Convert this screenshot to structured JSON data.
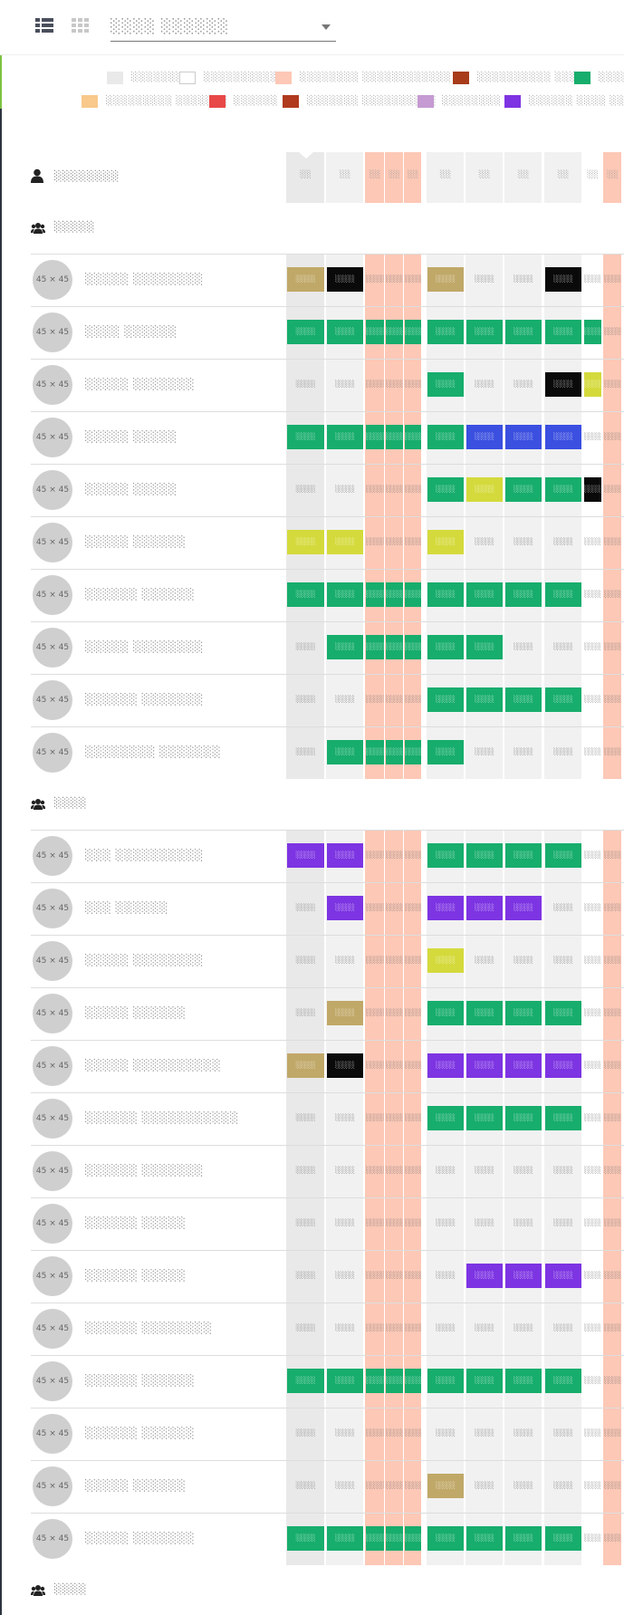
{
  "topbar": {
    "list_view_icon": "list-view-icon",
    "grid_view_icon": "grid-view-icon",
    "dropdown_value": "░░░░ ░░░░░░",
    "dropdown_icon": "chevron-down-icon"
  },
  "colors": {
    "gray": "#e9e9e9",
    "white": "#ffffff",
    "salmon": "#fdc8b6",
    "brown": "#a83c1b",
    "green": "#17ad6c",
    "peach": "#f8c98a",
    "red": "#e84848",
    "rust": "#b03a1e",
    "lilac": "#c69ad2",
    "purple": "#7d34e2",
    "khaki": "#c0a868",
    "black": "#0a0a0a",
    "lime": "#d4da3c",
    "blue": "#3b4fe0",
    "sidebar": "#2f3440",
    "accent": "#7cc242"
  },
  "legend": [
    {
      "color": "gray",
      "label": "░░░░░░░"
    },
    {
      "color": "white",
      "label": "░░░░░░░░░░░"
    },
    {
      "color": "salmon",
      "label": "░░░░░░░░ ░░░░░░░░░░░░"
    },
    {
      "color": "brown",
      "label": "░░░░░░░░░░ ░░░"
    },
    {
      "color": "green",
      "label": "░░░░░"
    },
    {
      "color": "peach",
      "label": "░░░░░░░░░ ░░░░░░░"
    },
    {
      "color": "red",
      "label": "░░░░░░"
    },
    {
      "color": "rust",
      "label": "░░░░░░░ ░░░░░░░░░░"
    },
    {
      "color": "lilac",
      "label": "░░░░░░░░"
    },
    {
      "color": "purple",
      "label": "░░░░░░ ░░░░ ░░░░░"
    }
  ],
  "header": {
    "icon": "user-icon",
    "label": "░░░░░░░░",
    "cells": [
      "░░",
      "░░",
      "░░",
      "░░",
      "░░",
      "░░",
      "░░",
      "░░",
      "░░",
      "░░",
      "░░",
      "░░"
    ]
  },
  "groups": [
    {
      "icon": "users-icon",
      "label": "░░░░░",
      "people": [
        {
          "avatar": "45 × 45",
          "name": "░░░░░ ░░░░░░░░",
          "cells": [
            "khaki",
            "black",
            "",
            "",
            "",
            "khaki",
            "",
            "",
            "black",
            "",
            "",
            ""
          ]
        },
        {
          "avatar": "45 × 45",
          "name": "░░░░ ░░░░░░",
          "cells": [
            "green",
            "green",
            "green",
            "green",
            "green",
            "green",
            "green",
            "green",
            "green",
            "green",
            "",
            ""
          ]
        },
        {
          "avatar": "45 × 45",
          "name": "░░░░░ ░░░░░░░",
          "cells": [
            "",
            "",
            "",
            "",
            "",
            "green",
            "",
            "",
            "black",
            "lime",
            "",
            ""
          ]
        },
        {
          "avatar": "45 × 45",
          "name": "░░░░░ ░░░░░",
          "cells": [
            "green",
            "green",
            "green",
            "green",
            "green",
            "green",
            "blue",
            "blue",
            "blue",
            "",
            "",
            ""
          ]
        },
        {
          "avatar": "45 × 45",
          "name": "░░░░░ ░░░░░",
          "cells": [
            "",
            "",
            "",
            "",
            "",
            "green",
            "lime",
            "green",
            "green",
            "black",
            "",
            ""
          ]
        },
        {
          "avatar": "45 × 45",
          "name": "░░░░░ ░░░░░░",
          "cells": [
            "lime",
            "lime",
            "",
            "",
            "",
            "lime",
            "",
            "",
            "",
            "",
            "",
            ""
          ]
        },
        {
          "avatar": "45 × 45",
          "name": "░░░░░░ ░░░░░░",
          "cells": [
            "green",
            "green",
            "green",
            "green",
            "green",
            "green",
            "green",
            "green",
            "green",
            "",
            "",
            ""
          ]
        },
        {
          "avatar": "45 × 45",
          "name": "░░░░░ ░░░░░░░░",
          "cells": [
            "",
            "green",
            "green",
            "green",
            "green",
            "green",
            "green",
            "",
            "",
            "",
            "",
            ""
          ]
        },
        {
          "avatar": "45 × 45",
          "name": "░░░░░░ ░░░░░░░",
          "cells": [
            "",
            "",
            "",
            "",
            "",
            "green",
            "green",
            "green",
            "green",
            "",
            "",
            ""
          ]
        },
        {
          "avatar": "45 × 45",
          "name": "░░░░░░░░ ░░░░░░░",
          "cells": [
            "",
            "green",
            "green",
            "green",
            "green",
            "green",
            "",
            "",
            "",
            "",
            "",
            ""
          ]
        }
      ]
    },
    {
      "icon": "users-icon",
      "label": "░░░░",
      "people": [
        {
          "avatar": "45 × 45",
          "name": "░░░ ░░░░░░░░░░",
          "cells": [
            "purple",
            "purple",
            "",
            "",
            "",
            "green",
            "green",
            "green",
            "green",
            "",
            "",
            ""
          ]
        },
        {
          "avatar": "45 × 45",
          "name": "░░░ ░░░░░░",
          "cells": [
            "",
            "purple",
            "",
            "",
            "",
            "purple",
            "purple",
            "purple",
            "",
            "",
            "",
            ""
          ]
        },
        {
          "avatar": "45 × 45",
          "name": "░░░░░ ░░░░░░░░",
          "cells": [
            "",
            "",
            "",
            "",
            "",
            "lime",
            "",
            "",
            "",
            "",
            "",
            ""
          ]
        },
        {
          "avatar": "45 × 45",
          "name": "░░░░░ ░░░░░░",
          "cells": [
            "",
            "khaki",
            "",
            "",
            "",
            "green",
            "green",
            "green",
            "green",
            "",
            "",
            ""
          ]
        },
        {
          "avatar": "45 × 45",
          "name": "░░░░░ ░░░░░░░░░░",
          "cells": [
            "khaki",
            "black",
            "",
            "",
            "",
            "purple",
            "purple",
            "purple",
            "purple",
            "",
            "",
            ""
          ]
        },
        {
          "avatar": "45 × 45",
          "name": "░░░░░░ ░░░░░░░░░░░",
          "cells": [
            "",
            "",
            "",
            "",
            "",
            "green",
            "green",
            "green",
            "green",
            "",
            "",
            ""
          ]
        },
        {
          "avatar": "45 × 45",
          "name": "░░░░░░ ░░░░░░░",
          "cells": [
            "",
            "",
            "",
            "",
            "",
            "",
            "",
            "",
            "",
            "",
            "",
            ""
          ]
        },
        {
          "avatar": "45 × 45",
          "name": "░░░░░░ ░░░░░",
          "cells": [
            "",
            "",
            "",
            "",
            "",
            "",
            "",
            "",
            "",
            "",
            "",
            ""
          ]
        },
        {
          "avatar": "45 × 45",
          "name": "░░░░░░ ░░░░░",
          "cells": [
            "",
            "",
            "",
            "",
            "",
            "",
            "purple",
            "purple",
            "purple",
            "",
            "",
            ""
          ]
        },
        {
          "avatar": "45 × 45",
          "name": "░░░░░░ ░░░░░░░░",
          "cells": [
            "",
            "",
            "",
            "",
            "",
            "",
            "",
            "",
            "",
            "",
            "",
            ""
          ]
        },
        {
          "avatar": "45 × 45",
          "name": "░░░░░░ ░░░░░░",
          "cells": [
            "green",
            "green",
            "green",
            "green",
            "green",
            "green",
            "green",
            "green",
            "green",
            "",
            "",
            ""
          ]
        },
        {
          "avatar": "45 × 45",
          "name": "░░░░░░ ░░░░░░",
          "cells": [
            "",
            "",
            "",
            "",
            "",
            "",
            "",
            "",
            "",
            "",
            "",
            ""
          ]
        },
        {
          "avatar": "45 × 45",
          "name": "░░░░░ ░░░░░░",
          "cells": [
            "",
            "",
            "",
            "",
            "",
            "khaki",
            "",
            "",
            "",
            "",
            "",
            ""
          ]
        },
        {
          "avatar": "45 × 45",
          "name": "░░░░░ ░░░░░░░",
          "cells": [
            "green",
            "green",
            "green",
            "green",
            "green",
            "green",
            "green",
            "green",
            "green",
            "",
            "",
            ""
          ]
        }
      ]
    },
    {
      "icon": "users-icon",
      "label": "░░░░",
      "people": []
    }
  ],
  "cell_text": "░░░░"
}
